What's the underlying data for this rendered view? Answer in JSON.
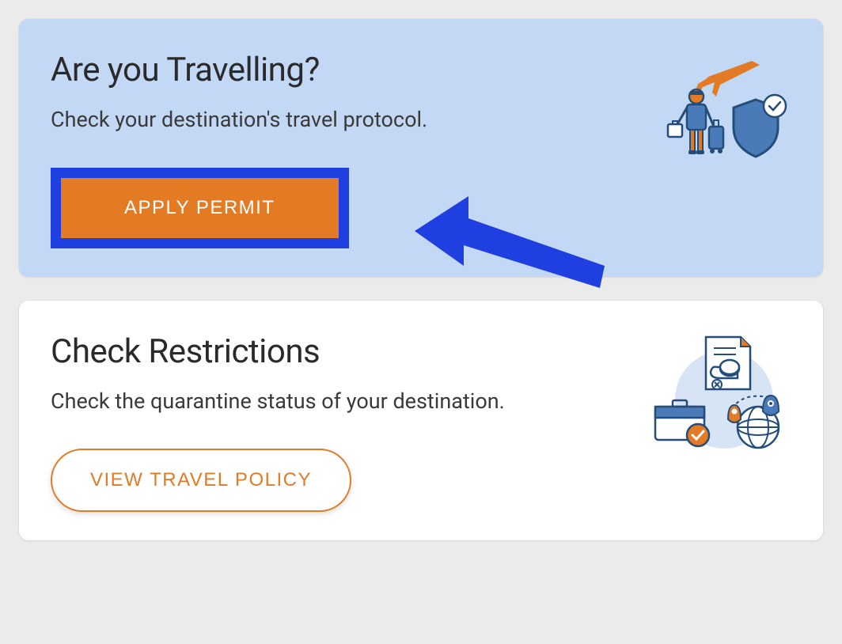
{
  "cards": {
    "travel": {
      "title": "Are you Travelling?",
      "description": "Check your destination's travel protocol.",
      "button_label": "APPLY PERMIT"
    },
    "restrictions": {
      "title": "Check Restrictions",
      "description": "Check the quarantine status of your destination.",
      "button_label": "VIEW TRAVEL POLICY"
    }
  },
  "colors": {
    "accent_orange": "#e27b24",
    "accent_blue": "#1f3fe0",
    "card_blue_bg": "#c2d8f5"
  }
}
